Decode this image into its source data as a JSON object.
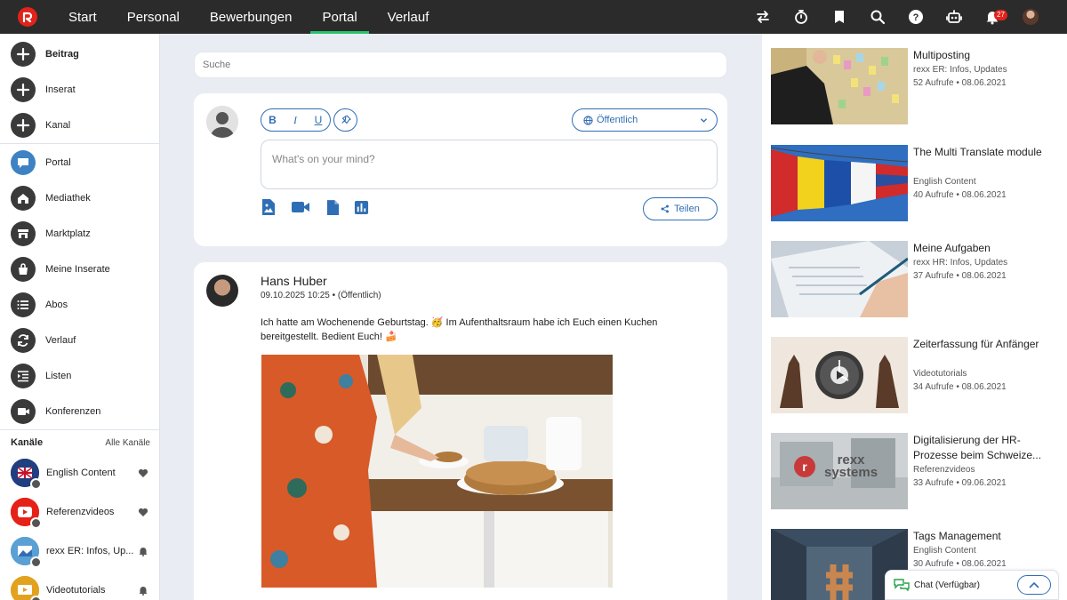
{
  "nav": {
    "tabs": [
      {
        "label": "Start"
      },
      {
        "label": "Personal"
      },
      {
        "label": "Bewerbungen"
      },
      {
        "label": "Portal",
        "active": true
      },
      {
        "label": "Verlauf"
      }
    ],
    "notification_count": "27",
    "accent_color": "#27c26c",
    "brand_color": "#e2231a"
  },
  "sidebar": {
    "create_items": [
      {
        "label": "Beitrag",
        "icon": "plus-icon"
      },
      {
        "label": "Inserat",
        "icon": "plus-icon"
      },
      {
        "label": "Kanal",
        "icon": "plus-icon"
      }
    ],
    "nav_items": [
      {
        "label": "Portal",
        "icon": "chat-bubble-icon"
      },
      {
        "label": "Mediathek",
        "icon": "home-icon"
      },
      {
        "label": "Marktplatz",
        "icon": "store-icon"
      },
      {
        "label": "Meine Inserate",
        "icon": "shopping-bag-icon"
      },
      {
        "label": "Abos",
        "icon": "list-icon"
      },
      {
        "label": "Verlauf",
        "icon": "refresh-icon"
      },
      {
        "label": "Listen",
        "icon": "list-indent-icon"
      },
      {
        "label": "Konferenzen",
        "icon": "video-camera-icon"
      }
    ],
    "channels_title": "Kanäle",
    "channels_link": "Alle Kanäle",
    "channels": [
      {
        "label": "English Content",
        "icon": "uk-flag-icon",
        "action": "heart-icon"
      },
      {
        "label": "Referenzvideos",
        "icon": "youtube-icon",
        "action": "heart-icon"
      },
      {
        "label": "rexx ER: Infos, Up...",
        "icon": "channel-icon",
        "action": "bell-icon"
      },
      {
        "label": "Videotutorials",
        "icon": "tutorial-icon",
        "action": "bell-icon"
      }
    ]
  },
  "feed": {
    "search_placeholder": "Suche",
    "composer": {
      "placeholder": "What's on your mind?",
      "visibility": "Öffentlich",
      "share_label": "Teilen",
      "format_bold": "B",
      "format_italic": "I",
      "format_underline": "U"
    },
    "post": {
      "author": "Hans Huber",
      "meta": "09.10.2025 10:25 • (Öffentlich)",
      "text": "Ich hatte am Wochenende Geburtstag. 🥳 Im Aufenthaltsraum habe ich Euch einen Kuchen bereitgestellt. Bedient Euch! 🍰"
    }
  },
  "rail": {
    "videos": [
      {
        "title": "Multiposting",
        "channel": "rexx ER: Infos, Updates",
        "stats": "52 Aufrufe • 08.06.2021"
      },
      {
        "title": "The Multi Translate module",
        "channel": "English Content",
        "stats": "40 Aufrufe • 08.06.2021"
      },
      {
        "title": "Meine Aufgaben",
        "channel": "rexx HR: Infos, Updates",
        "stats": "37 Aufrufe • 08.06.2021"
      },
      {
        "title": "Zeiterfassung für Anfänger",
        "channel": "Videotutorials",
        "stats": "34 Aufrufe • 08.06.2021"
      },
      {
        "title": "Digitalisierung der HR-Prozesse beim Schweize...",
        "channel": "Referenzvideos",
        "stats": "33 Aufrufe • 09.06.2021"
      },
      {
        "title": "Tags Management",
        "channel": "English Content",
        "stats": "30 Aufrufe • 08.06.2021"
      }
    ],
    "thumb4_brand": "rexx systems"
  },
  "chat": {
    "label": "Chat (Verfügbar)"
  }
}
